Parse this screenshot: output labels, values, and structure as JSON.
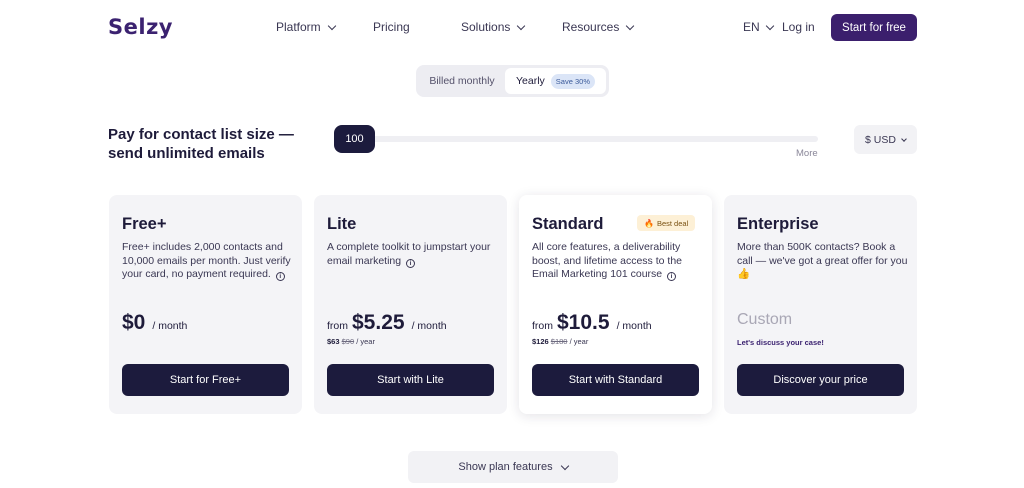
{
  "header": {
    "logo": "Selzy",
    "nav": [
      {
        "label": "Platform",
        "has_dropdown": true
      },
      {
        "label": "Pricing",
        "has_dropdown": false
      },
      {
        "label": "Solutions",
        "has_dropdown": true
      },
      {
        "label": "Resources",
        "has_dropdown": true
      }
    ],
    "language": "EN",
    "login": "Log in",
    "cta": "Start for free"
  },
  "billing": {
    "monthly_label": "Billed monthly",
    "yearly_label": "Yearly",
    "save_badge": "Save 30%",
    "selected": "yearly"
  },
  "contacts": {
    "title_line1": "Pay for contact list size —",
    "title_line2": "send unlimited emails",
    "value": "100",
    "more_label": "More",
    "currency": "$ USD"
  },
  "plans": [
    {
      "name": "Free+",
      "description": "Free+ includes 2,000 contacts and 10,000 emails per month. Just verify your card, no payment required.",
      "price_from": "",
      "price": "$0",
      "period": "/ month",
      "button": "Start for Free+"
    },
    {
      "name": "Lite",
      "description": "A complete toolkit to jumpstart your email marketing",
      "price_from": "from",
      "price": "$5.25",
      "period": "/ month",
      "yearly_price": "$63",
      "yearly_old_price": "$90",
      "yearly_unit": "/ year",
      "button": "Start with Lite"
    },
    {
      "name": "Standard",
      "badge": "Best deal",
      "description": "All core features, a deliverability boost, and lifetime access to the Email Marketing 101 course",
      "price_from": "from",
      "price": "$10.5",
      "period": "/ month",
      "yearly_price": "$126",
      "yearly_old_price": "$180",
      "yearly_unit": "/ year",
      "button": "Start with Standard"
    },
    {
      "name": "Enterprise",
      "description": "More than 500K contacts? Book a call — we've got a great offer for you",
      "emoji": "👍",
      "price": "Custom",
      "subtext": "Let's discuss your case!",
      "button": "Discover your price"
    }
  ],
  "show_features": "Show plan features",
  "colors": {
    "brand": "#3b1f6d",
    "button_dark": "#1c1b3d",
    "card_bg": "#f4f4f7",
    "badge_bg": "#fdf0d6",
    "save_badge_bg": "#dbe5f7"
  }
}
